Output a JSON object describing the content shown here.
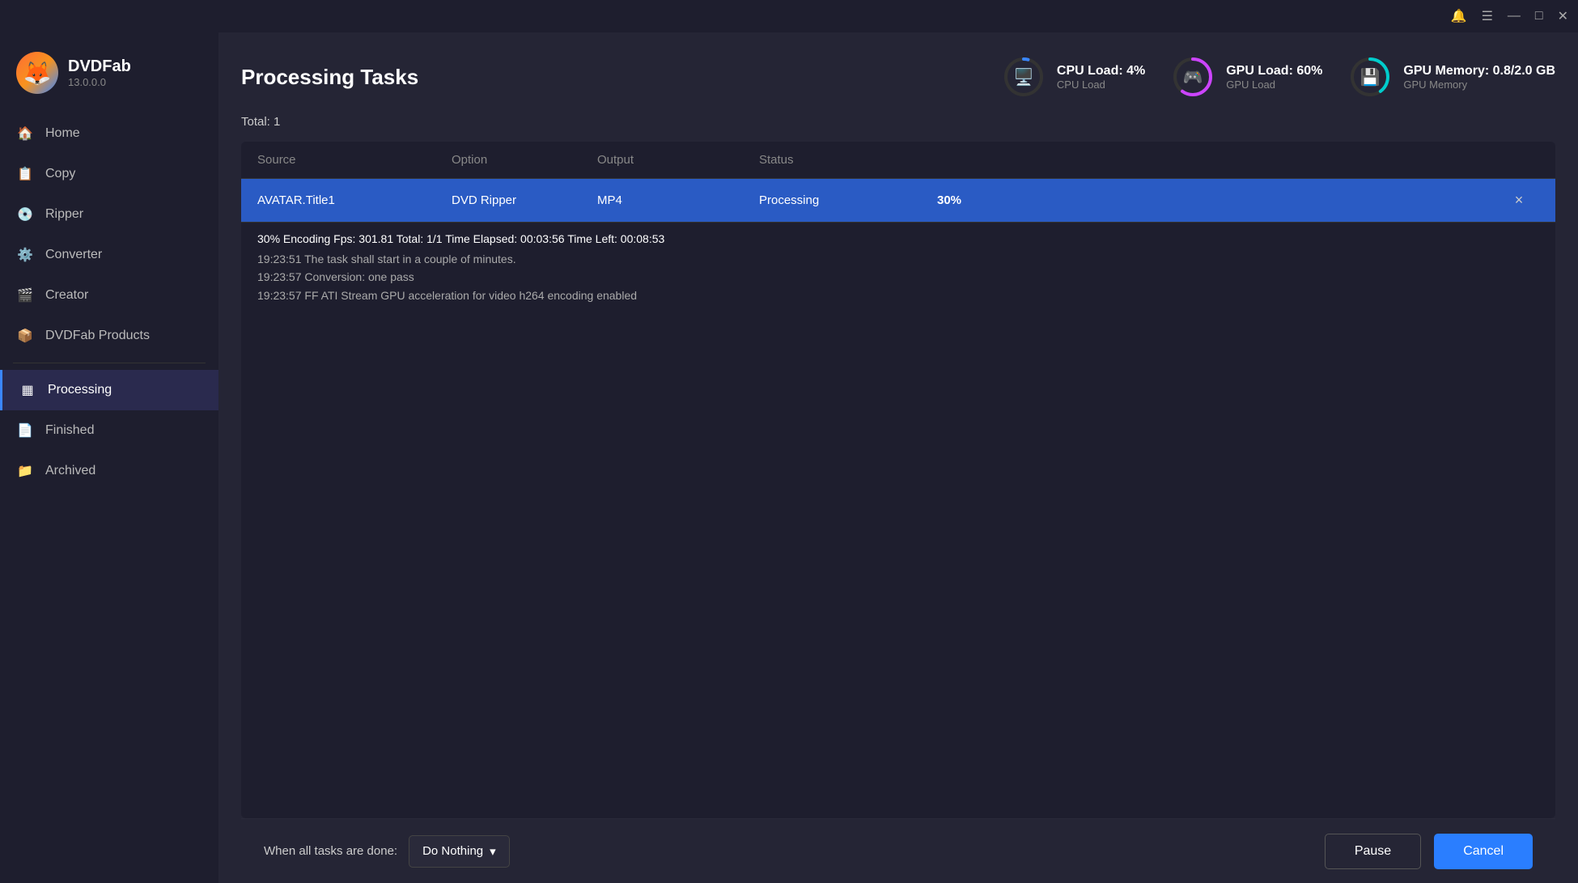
{
  "titlebar": {
    "icons": [
      "notification-icon",
      "menu-icon",
      "minimize-icon",
      "maximize-icon",
      "close-icon"
    ]
  },
  "sidebar": {
    "logo": {
      "name": "DVDFab",
      "version": "13.0.0.0"
    },
    "items": [
      {
        "id": "home",
        "label": "Home",
        "icon": "🏠"
      },
      {
        "id": "copy",
        "label": "Copy",
        "icon": "📋"
      },
      {
        "id": "ripper",
        "label": "Ripper",
        "icon": "💿"
      },
      {
        "id": "converter",
        "label": "Converter",
        "icon": "⚙️"
      },
      {
        "id": "creator",
        "label": "Creator",
        "icon": "🎬"
      },
      {
        "id": "dvdfab-products",
        "label": "DVDFab Products",
        "icon": "📦"
      },
      {
        "id": "processing",
        "label": "Processing",
        "icon": "▦",
        "active": true
      },
      {
        "id": "finished",
        "label": "Finished",
        "icon": "📄"
      },
      {
        "id": "archived",
        "label": "Archived",
        "icon": "📁"
      }
    ]
  },
  "main": {
    "page_title": "Processing Tasks",
    "total_label": "Total:  1",
    "stats": {
      "cpu": {
        "label": "CPU Load: 4%",
        "sublabel": "CPU Load",
        "value": 4,
        "icon": "🖥️",
        "color": "#3a86ff"
      },
      "gpu": {
        "label": "GPU Load: 60%",
        "sublabel": "GPU Load",
        "value": 60,
        "icon": "🎮",
        "color": "#cc44ff"
      },
      "memory": {
        "label": "GPU Memory: 0.8/2.0 GB",
        "sublabel": "GPU Memory",
        "value": 40,
        "icon": "💾",
        "color": "#00cccc"
      }
    },
    "table": {
      "columns": [
        "Source",
        "Option",
        "Output",
        "Status",
        "",
        ""
      ],
      "row": {
        "source": "AVATAR.Title1",
        "option": "DVD Ripper",
        "output": "MP4",
        "status": "Processing",
        "progress": "30%",
        "close": "×"
      },
      "log": {
        "progress_line": "30%  Encoding Fps: 301.81  Total: 1/1  Time Elapsed: 00:03:56  Time Left: 00:08:53",
        "lines": [
          "19:23:51  The task shall start in a couple of minutes.",
          "19:23:57  Conversion: one pass",
          "19:23:57  FF ATI Stream GPU acceleration for video h264 encoding enabled"
        ]
      }
    },
    "bottom": {
      "when_done_label": "When all tasks are done:",
      "when_done_value": "Do Nothing",
      "pause_label": "Pause",
      "cancel_label": "Cancel"
    }
  }
}
